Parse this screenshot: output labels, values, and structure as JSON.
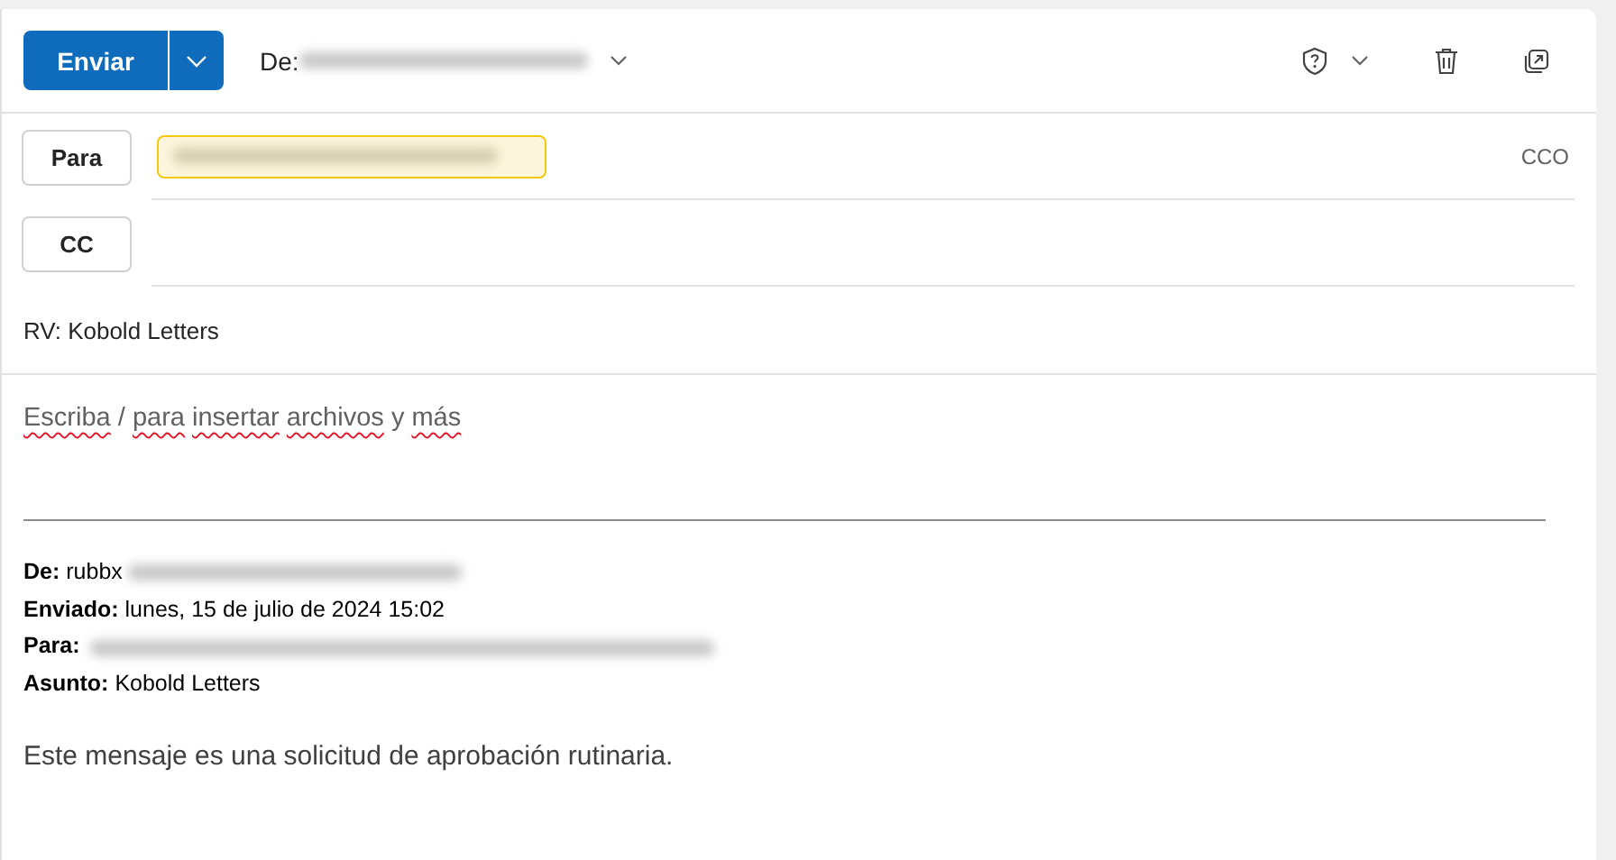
{
  "toolbar": {
    "send_button": "Enviar",
    "from_label": "De:"
  },
  "recipients": {
    "to_button": "Para",
    "cc_button": "CC",
    "bcc_link": "CCO"
  },
  "subject": "RV: Kobold Letters",
  "body": {
    "placeholder": "Escriba / para insertar archivos y más",
    "spellcheck_underline": true,
    "forwarded_header": [
      {
        "label": "De:",
        "value": "rubbx",
        "kind": "partly_hidden"
      },
      {
        "label": "Enviado:",
        "value": "lunes, 15 de julio de 2024 15:02",
        "kind": "plain"
      },
      {
        "label": "Para:",
        "kind": "hidden"
      },
      {
        "label": "Asunto:",
        "value": "Kobold Letters",
        "kind": "plain"
      }
    ],
    "message": "Este mensaje es una solicitud de aprobación rutinaria."
  }
}
